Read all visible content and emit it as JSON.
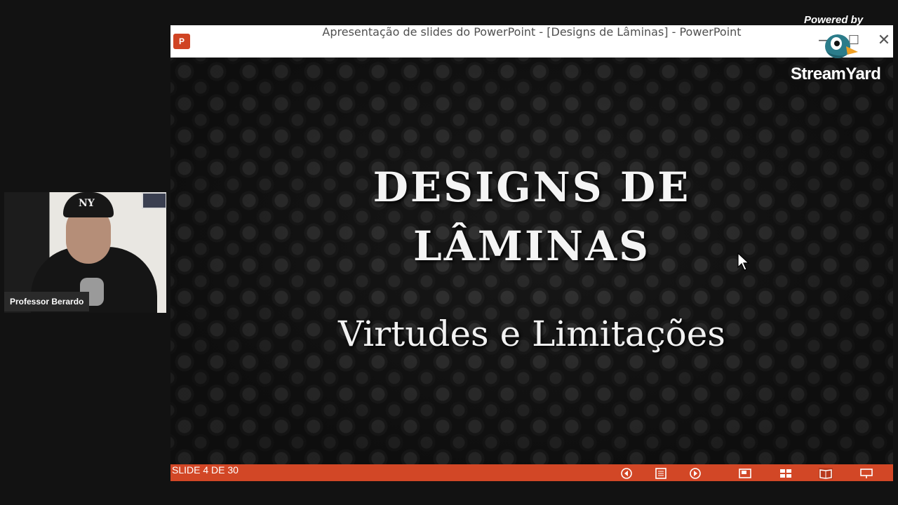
{
  "window": {
    "title": "Apresentação de slides do PowerPoint - [Designs de Lâminas] - PowerPoint",
    "app_icon_letter": "P",
    "minimize_label": "—",
    "maximize_label": "☐",
    "close_label": "✕"
  },
  "slide": {
    "title_line1": "DESIGNS DE",
    "title_line2": "LÂMINAS",
    "subtitle": "Virtudes e Limitações"
  },
  "statusbar": {
    "slide_counter": "SLIDE 4 DE 30",
    "color": "#d24726",
    "icons": [
      "previous-icon",
      "notes-icon",
      "next-icon",
      "normal-view-icon",
      "slide-sorter-icon",
      "reading-view-icon",
      "slideshow-icon"
    ]
  },
  "webcam": {
    "name": "Professor Berardo",
    "cap_logo": "NY"
  },
  "branding": {
    "powered_by": "Powered by",
    "product": "StreamYard"
  }
}
